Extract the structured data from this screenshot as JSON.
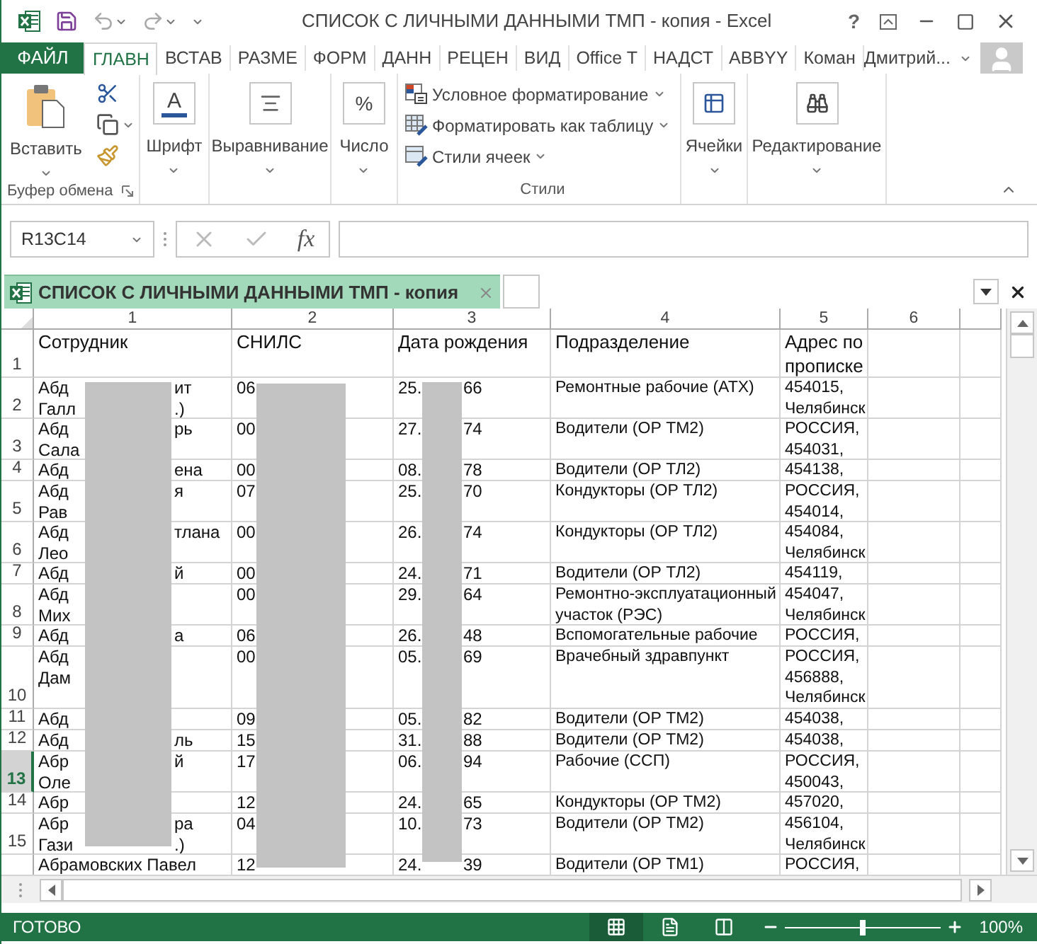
{
  "window": {
    "title": "СПИСОК С ЛИЧНЫМИ ДАННЫМИ ТМП - копия - Excel",
    "help": "?"
  },
  "ribbon_tabs": [
    {
      "label": "ФАЙЛ",
      "kind": "file",
      "selected": false
    },
    {
      "label": "ГЛАВН",
      "kind": "tab",
      "selected": true
    },
    {
      "label": "ВСТАВ",
      "kind": "tab",
      "selected": false
    },
    {
      "label": "РАЗМЕ",
      "kind": "tab",
      "selected": false
    },
    {
      "label": "ФОРМ",
      "kind": "tab",
      "selected": false
    },
    {
      "label": "ДАНН",
      "kind": "tab",
      "selected": false
    },
    {
      "label": "РЕЦЕН",
      "kind": "tab",
      "selected": false
    },
    {
      "label": "ВИД",
      "kind": "tab",
      "selected": false
    },
    {
      "label": "Office T",
      "kind": "tab",
      "selected": false
    },
    {
      "label": "НАДСТ",
      "kind": "tab",
      "selected": false
    },
    {
      "label": "ABBYY",
      "kind": "tab",
      "selected": false
    },
    {
      "label": "Коман",
      "kind": "tab",
      "selected": false
    }
  ],
  "user": "Дмитрий...",
  "ribbon": {
    "clipboard": {
      "paste": "Вставить",
      "label": "Буфер обмена"
    },
    "font": {
      "glyph": "A",
      "label": "Шрифт"
    },
    "alignment": "Выравнивание",
    "number": {
      "glyph": "%",
      "label": "Число"
    },
    "styles": {
      "items": [
        "Условное форматирование",
        "Форматировать как таблицу",
        "Стили ячеек"
      ],
      "label": "Стили"
    },
    "cells": "Ячейки",
    "editing": "Редактирование"
  },
  "formula_bar": {
    "name_box": "R13C14",
    "function_label": "fx"
  },
  "workbook_tab": {
    "title": "СПИСОК С ЛИЧНЫМИ ДАННЫМИ ТМП - копия"
  },
  "sheet": {
    "columns": [
      "1",
      "2",
      "3",
      "4",
      "5",
      "6"
    ],
    "header": {
      "number": "1",
      "selected": false,
      "cells": [
        "Сотрудник",
        "СНИЛС",
        "Дата рождения",
        "Подразделение",
        [
          "Адрес по",
          "прописке"
        ]
      ]
    },
    "rows": [
      {
        "number": "2",
        "selected": false,
        "name": [
          {
            "start": "Абд",
            "end": "ит"
          },
          {
            "start": "Галл",
            "end": ".)"
          }
        ],
        "snils": "06",
        "date": {
          "start": "25.",
          "end": "66"
        },
        "department": [
          "Ремонтные рабочие (АТХ)"
        ],
        "address": [
          "454015,",
          "Челябинск"
        ]
      },
      {
        "number": "3",
        "selected": false,
        "name": [
          {
            "start": "Абд",
            "end": "рь"
          },
          {
            "start": "Сала"
          }
        ],
        "snils": "00",
        "date": {
          "start": "27.",
          "end": "74"
        },
        "department": [
          "Водители (ОР ТМ2)"
        ],
        "address": [
          "РОССИЯ,",
          "454031,"
        ]
      },
      {
        "number": "4",
        "selected": false,
        "name": [
          {
            "start": "Абд",
            "end": "ена"
          }
        ],
        "snils": "00",
        "date": {
          "start": "08.",
          "end": "78"
        },
        "department": [
          "Водители (ОР ТЛ2)"
        ],
        "address": [
          "454138,"
        ]
      },
      {
        "number": "5",
        "selected": false,
        "name": [
          {
            "start": "Абд",
            "end": "я"
          },
          {
            "start": "Рав"
          }
        ],
        "snils": "07",
        "date": {
          "start": "25.",
          "end": "70"
        },
        "department": [
          "Кондукторы (ОР ТЛ2)"
        ],
        "address": [
          "РОССИЯ,",
          "454014,"
        ]
      },
      {
        "number": "6",
        "selected": false,
        "name": [
          {
            "start": "Абд",
            "end": "тлана"
          },
          {
            "start": "Лео"
          }
        ],
        "snils": "00",
        "date": {
          "start": "26.",
          "end": "74"
        },
        "department": [
          "Кондукторы (ОР ТЛ2)"
        ],
        "address": [
          "454084,",
          "Челябинск"
        ]
      },
      {
        "number": "7",
        "selected": false,
        "name": [
          {
            "start": "Абд",
            "end": "й"
          }
        ],
        "snils": "00",
        "date": {
          "start": "24.",
          "end": "71"
        },
        "department": [
          "Водители (ОР ТЛ2)"
        ],
        "address": [
          "454119,"
        ]
      },
      {
        "number": "8",
        "selected": false,
        "name": [
          {
            "start": "Абд"
          },
          {
            "start": "Мих"
          }
        ],
        "snils": "00",
        "date": {
          "start": "29.",
          "end": "64"
        },
        "department": [
          "Ремонтно-эксплуатационный",
          "участок (РЭС)"
        ],
        "address": [
          "454047,",
          "Челябинск"
        ]
      },
      {
        "number": "9",
        "selected": false,
        "name": [
          {
            "start": "Абд",
            "end": "а"
          }
        ],
        "snils": "06",
        "date": {
          "start": "26.",
          "end": "48"
        },
        "department": [
          "Вспомогательные рабочие"
        ],
        "address": [
          "РОССИЯ,"
        ]
      },
      {
        "number": "10",
        "selected": false,
        "name": [
          {
            "start": "Абд"
          },
          {
            "start": "Дам"
          }
        ],
        "snils": "00",
        "date": {
          "start": "05.",
          "end": "69"
        },
        "department": [
          "Врачебный здравпункт"
        ],
        "address": [
          "РОССИЯ,",
          "456888,",
          "Челябинск"
        ]
      },
      {
        "number": "11",
        "selected": false,
        "name": [
          {
            "start": "Абд"
          }
        ],
        "snils": "09",
        "date": {
          "start": "05.",
          "end": "82"
        },
        "department": [
          "Водители (ОР ТМ2)"
        ],
        "address": [
          "454038,"
        ]
      },
      {
        "number": "12",
        "selected": false,
        "name": [
          {
            "start": "Абд",
            "end": "ль"
          }
        ],
        "snils": "15",
        "date": {
          "start": "31.",
          "end": "88"
        },
        "department": [
          "Водители (ОР ТМ2)"
        ],
        "address": [
          "454038,"
        ]
      },
      {
        "number": "13",
        "selected": true,
        "name": [
          {
            "start": "Абр",
            "end": "й"
          },
          {
            "start": "Оле"
          }
        ],
        "snils": "17",
        "date": {
          "start": "06.",
          "end": "94"
        },
        "department": [
          "Рабочие (ССП)"
        ],
        "address": [
          "РОССИЯ,",
          "450043,"
        ]
      },
      {
        "number": "14",
        "selected": false,
        "name": [
          {
            "start": "Абр"
          }
        ],
        "snils": "12",
        "date": {
          "start": "24.",
          "end": "65"
        },
        "department": [
          "Кондукторы (ОР ТМ2)"
        ],
        "address": [
          "457020,"
        ]
      },
      {
        "number": "15",
        "selected": false,
        "name": [
          {
            "start": "Абр",
            "end": "ра"
          },
          {
            "start": "Гази",
            "end": ".)"
          }
        ],
        "snils": "04",
        "date": {
          "start": "10.",
          "end": "73"
        },
        "department": [
          "Водители (ОР ТМ2)"
        ],
        "address": [
          "456104,",
          "Челябинск"
        ]
      },
      {
        "selected": false,
        "name": [
          {
            "start": "Абрамовских Павел"
          }
        ],
        "snils": "12",
        "date": {
          "start": "24.",
          "end": "39"
        },
        "department": [
          "Водители (ОР ТМ1)"
        ],
        "address": [
          "РОССИЯ,"
        ]
      }
    ]
  },
  "status_bar": {
    "text": "ГОТОВО",
    "zoom": "100%",
    "zoom_slider": {
      "level": 0.5
    }
  }
}
